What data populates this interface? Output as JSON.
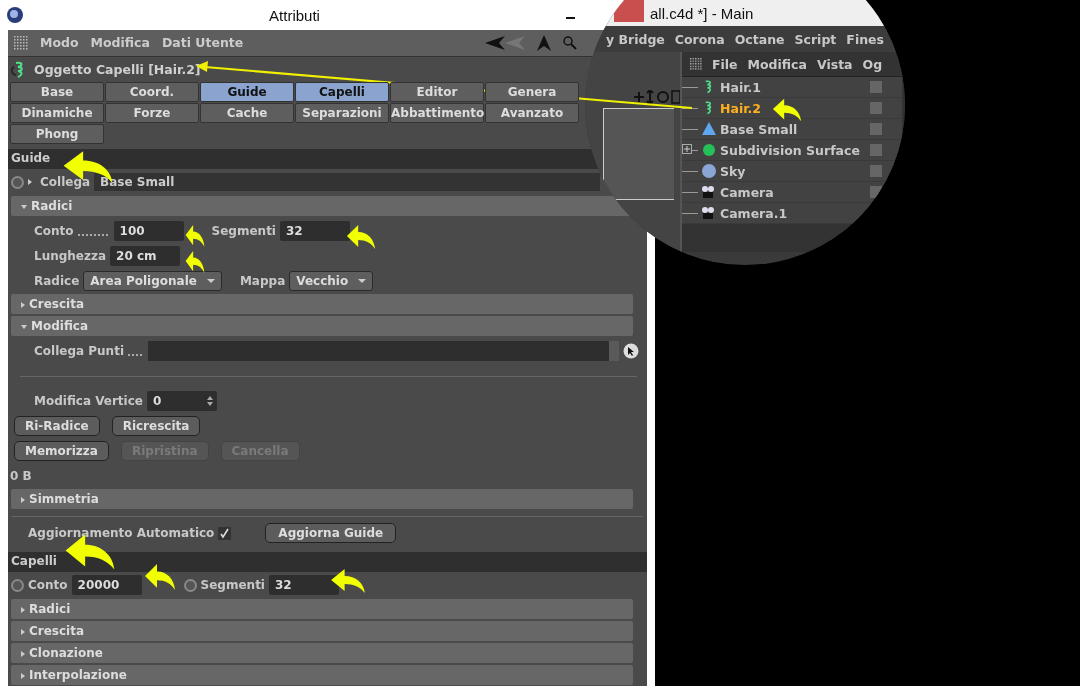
{
  "window": {
    "title": "Attributi"
  },
  "menu": [
    "Modo",
    "Modifica",
    "Dati Utente"
  ],
  "object_title": "Oggetto Capelli [Hair.2]",
  "tabs": [
    {
      "label": "Base",
      "selected": false
    },
    {
      "label": "Coord.",
      "selected": false
    },
    {
      "label": "Guide",
      "selected": true
    },
    {
      "label": "Capelli",
      "selected": true
    },
    {
      "label": "Editor",
      "selected": false
    },
    {
      "label": "Genera",
      "selected": false
    },
    {
      "label": "Dinamiche",
      "selected": false
    },
    {
      "label": "Forze",
      "selected": false
    },
    {
      "label": "Cache",
      "selected": false
    },
    {
      "label": "Separazioni",
      "selected": false
    },
    {
      "label": "Abbattimento",
      "selected": false
    },
    {
      "label": "Avanzato",
      "selected": false
    },
    {
      "label": "Phong",
      "selected": false
    }
  ],
  "guide_section": {
    "title": "Guide",
    "link_label": "Collega",
    "link_value": "Base Small",
    "link_keyframed": false,
    "groups": [
      {
        "title": "Radici",
        "expanded": true,
        "lines": [
          [
            {
              "kind": "field",
              "label": "Conto",
              "value": "100",
              "leader": true
            },
            {
              "kind": "field",
              "label": "Segmenti",
              "value": "32",
              "leader": false
            }
          ],
          [
            {
              "kind": "field",
              "label": "Lunghezza",
              "value": "20 cm",
              "leader": false
            }
          ],
          [
            {
              "kind": "dropdown",
              "label": "Radice",
              "value": "Area Poligonale"
            },
            {
              "kind": "dropdown",
              "label": "Mappa",
              "value": "Vecchio"
            }
          ]
        ]
      },
      {
        "title": "Crescita",
        "expanded": false
      },
      {
        "title": "Modifica",
        "expanded": true,
        "lines": [
          [
            {
              "kind": "link",
              "label": "Collega Punti",
              "leader": true
            }
          ],
          [
            {
              "kind": "divider"
            }
          ],
          [
            {
              "kind": "spinner",
              "label": "Modifica Vertice",
              "value": "0"
            }
          ],
          [
            {
              "kind": "button",
              "label": "Ri-Radice",
              "disabled": false
            },
            {
              "kind": "button",
              "label": "Ricrescita",
              "disabled": false
            }
          ],
          [
            {
              "kind": "button",
              "label": "Memorizza",
              "disabled": false
            },
            {
              "kind": "button",
              "label": "Ripristina",
              "disabled": true
            },
            {
              "kind": "button",
              "label": "Cancella",
              "disabled": true
            }
          ],
          [
            {
              "kind": "text",
              "label": "0 B"
            }
          ]
        ]
      },
      {
        "title": "Simmetria",
        "expanded": false
      }
    ],
    "auto_update": {
      "label": "Aggiornamento Automatico",
      "checked": true
    },
    "update_button": "Aggiorna Guide"
  },
  "hair_section": {
    "title": "Capelli",
    "fields": [
      {
        "label": "Conto",
        "value": "20000",
        "keyframed": false
      },
      {
        "label": "Segmenti",
        "value": "32",
        "keyframed": false
      }
    ],
    "groups": [
      {
        "title": "Radici",
        "expanded": false
      },
      {
        "title": "Crescita",
        "expanded": false
      },
      {
        "title": "Clonazione",
        "expanded": false
      },
      {
        "title": "Interpolazione",
        "expanded": false
      }
    ]
  },
  "main_window": {
    "title": "all.c4d *] - Main",
    "menu": [
      "y Bridge",
      "Corona",
      "Octane",
      "Script",
      "Fines"
    ],
    "object_manager": {
      "menu": [
        "File",
        "Modifica",
        "Vista",
        "Og"
      ],
      "objects": [
        {
          "name": "Hair.1",
          "kind": "hair",
          "selected": false,
          "expandable": false
        },
        {
          "name": "Hair.2",
          "kind": "hair",
          "selected": true,
          "expandable": false
        },
        {
          "name": "Base Small",
          "kind": "cone",
          "selected": false,
          "expandable": false
        },
        {
          "name": "Subdivision Surface",
          "kind": "subdivision",
          "selected": false,
          "expandable": true
        },
        {
          "name": "Sky",
          "kind": "sky",
          "selected": false,
          "expandable": false
        },
        {
          "name": "Camera",
          "kind": "camera",
          "selected": false,
          "expandable": false
        },
        {
          "name": "Camera.1",
          "kind": "camera",
          "selected": false,
          "expandable": false
        }
      ]
    }
  }
}
